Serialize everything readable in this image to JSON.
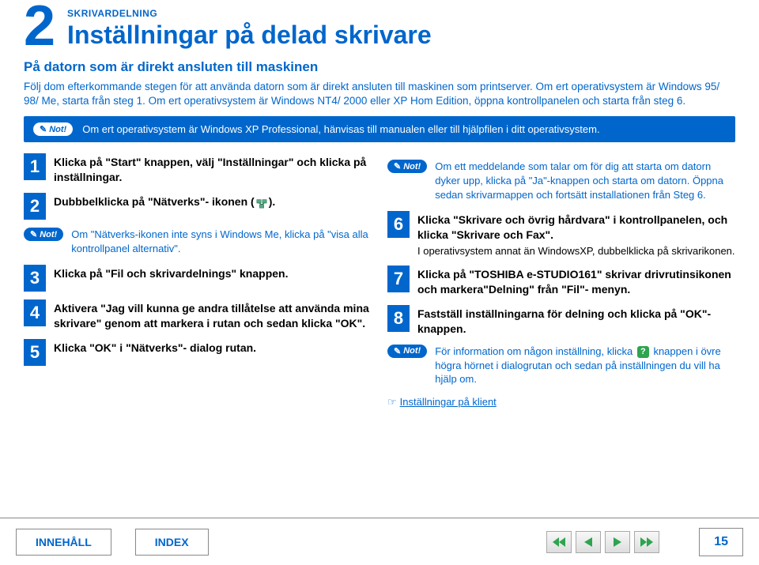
{
  "header": {
    "chapter_number": "2",
    "section_label": "SKRIVARDELNING",
    "title": "Inställningar på delad skrivare",
    "subtitle": "På datorn som är direkt ansluten till maskinen",
    "intro": "Följ dom efterkommande stegen för att använda datorn som är direkt ansluten till maskinen som printserver. Om ert operativsystem är Windows 95/ 98/ Me, starta från steg 1. Om ert operativsystem är Windows NT4/ 2000 eller XP Hom Edition, öppna kontrollpanelen och starta från steg 6."
  },
  "note_label": "Not!",
  "top_note": "Om ert operativsystem är Windows XP Professional, hänvisas till manualen eller till hjälpfilen i ditt operativsystem.",
  "left": {
    "steps": [
      {
        "n": "1",
        "text": "Klicka på \"Start\" knappen, välj \"Inställningar\" och klicka på inställningar."
      },
      {
        "n": "2",
        "text_a": "Dubbbelklicka på \"Nätverks\"- ikonen (",
        "text_b": ")."
      },
      {
        "n": "3",
        "text": "Klicka på \"Fil och skrivardelnings\" knappen."
      },
      {
        "n": "4",
        "text": "Aktivera \"Jag vill kunna ge andra tillåtelse att använda mina skrivare\" genom att  markera i rutan och sedan klicka \"OK\"."
      },
      {
        "n": "5",
        "text": "Klicka \"OK\" i \"Nätverks\"- dialog rutan."
      }
    ],
    "note": "Om \"Nätverks-ikonen inte syns i Windows Me, klicka på \"visa alla kontrollpanel alternativ\"."
  },
  "right": {
    "note1": "Om ett meddelande som talar om för dig att starta om datorn dyker upp, klicka på \"Ja\"-knappen och starta om datorn. Öppna sedan skrivarmappen och fortsätt installationen från Steg 6.",
    "steps": [
      {
        "n": "6",
        "text": "Klicka \"Skrivare och övrig hårdvara\" i kontrollpanelen, och klicka \"Skrivare och Fax\".",
        "sub": "I operativsystem annat än WindowsXP, dubbelklicka på skrivarikonen."
      },
      {
        "n": "7",
        "text": "Klicka på \"TOSHIBA e-STUDIO161\" skrivar drivrutinsikonen och markera\"Delning\" från \"Fil\"- menyn."
      },
      {
        "n": "8",
        "text": "Fastställ inställningarna för delning och klicka på \"OK\"- knappen."
      }
    ],
    "note2_a": "För information om någon inställning, klicka ",
    "note2_b": " knappen i övre högra hörnet i dialogrutan och sedan på inställningen du vill ha hjälp om.",
    "help_char": "?",
    "link": "Inställningar på klient"
  },
  "footer": {
    "contents": "INNEHÅLL",
    "index": "INDEX",
    "page": "15"
  }
}
